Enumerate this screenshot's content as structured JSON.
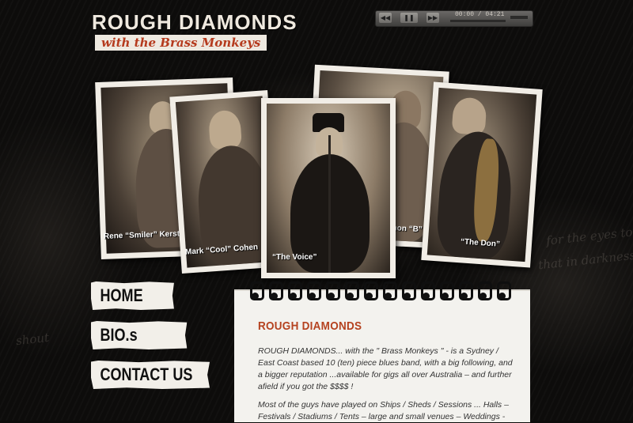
{
  "logo": {
    "title": "ROUGH DIAMONDS",
    "subtitle": "with the Brass Monkeys"
  },
  "player": {
    "time": "00:00 / 04:21",
    "buttons": [
      "rewind-icon",
      "pause-icon",
      "forward-icon"
    ]
  },
  "photos": [
    {
      "caption": "Rene “Smiler” Kerstens"
    },
    {
      "caption": "Mark “Cool” Cohen"
    },
    {
      "caption": "“The Voice”"
    },
    {
      "caption": "Simon “B”"
    },
    {
      "caption": "“The Don”"
    }
  ],
  "nav": {
    "home": "HOME",
    "bios": "BIO.s",
    "contact": "CONTACT US"
  },
  "content": {
    "heading": "ROUGH DIAMONDS",
    "para1": "ROUGH DIAMONDS... with the \" Brass Monkeys \" - is a Sydney / East Coast based 10 (ten) piece blues band, with a big following, and a bigger reputation ...available for gigs all over Australia – and further afield if you got the $$$$ !",
    "para2": "Most of the guys have played on Ships / Sheds / Sessions ... Halls – Festivals / Stadiums / Tents – large and small venues – Weddings -"
  },
  "colors": {
    "accent": "#b5421f",
    "background": "#0d0c0b",
    "paper": "#f3f2ee"
  }
}
